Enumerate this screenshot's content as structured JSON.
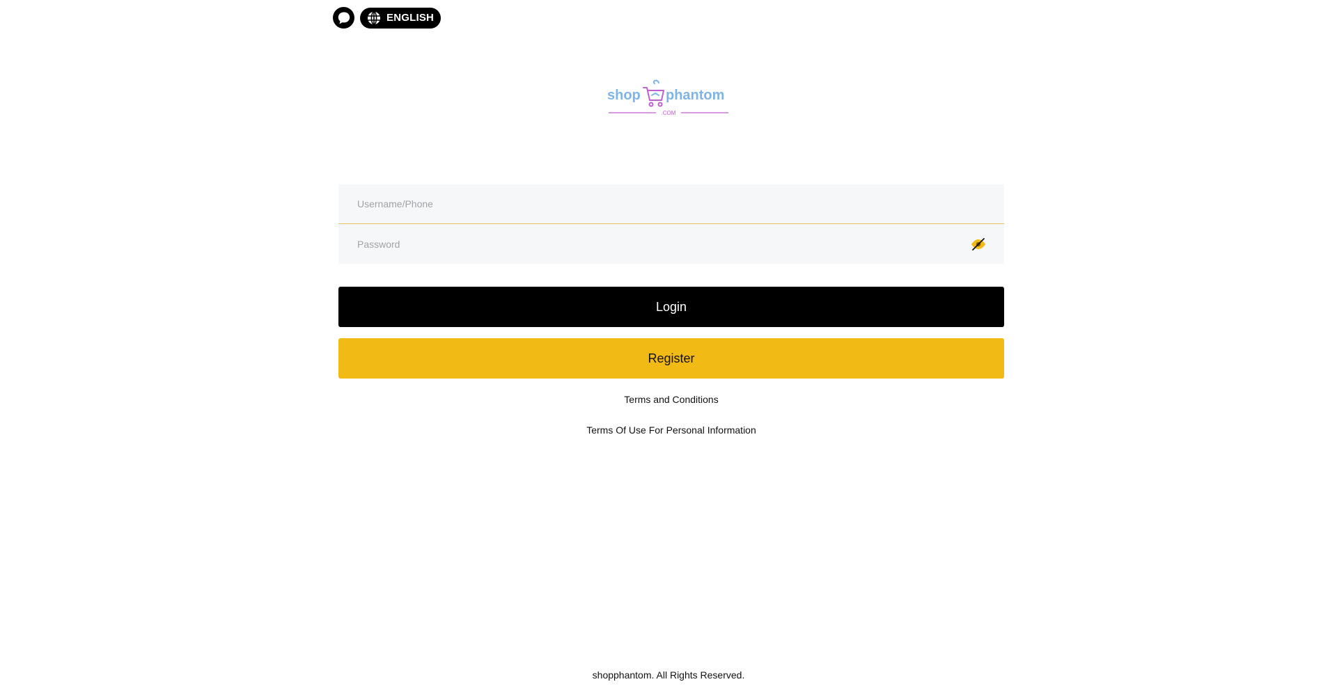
{
  "header": {
    "support_icon": "chat-bubble-icon",
    "language_icon": "globe-icon",
    "language_label": "ENGLISH"
  },
  "logo": {
    "text_left": "shop",
    "text_right": "phantom",
    "text_sub": ".COM",
    "colors": {
      "primary": "#7fb4e8",
      "accent": "#c05fd0"
    }
  },
  "form": {
    "username_placeholder": "Username/Phone",
    "password_placeholder": "Password",
    "password_toggle_icon": "eye-slash-icon",
    "login_label": "Login",
    "register_label": "Register"
  },
  "links": {
    "terms": "Terms and Conditions",
    "privacy": "Terms Of Use For Personal Information"
  },
  "footer": {
    "copyright": "shopphantom. All Rights Reserved."
  },
  "colors": {
    "login_bg": "#000000",
    "register_bg": "#f2ba14",
    "field_bg": "#f6f7f8",
    "field_border": "#e4c15a"
  }
}
